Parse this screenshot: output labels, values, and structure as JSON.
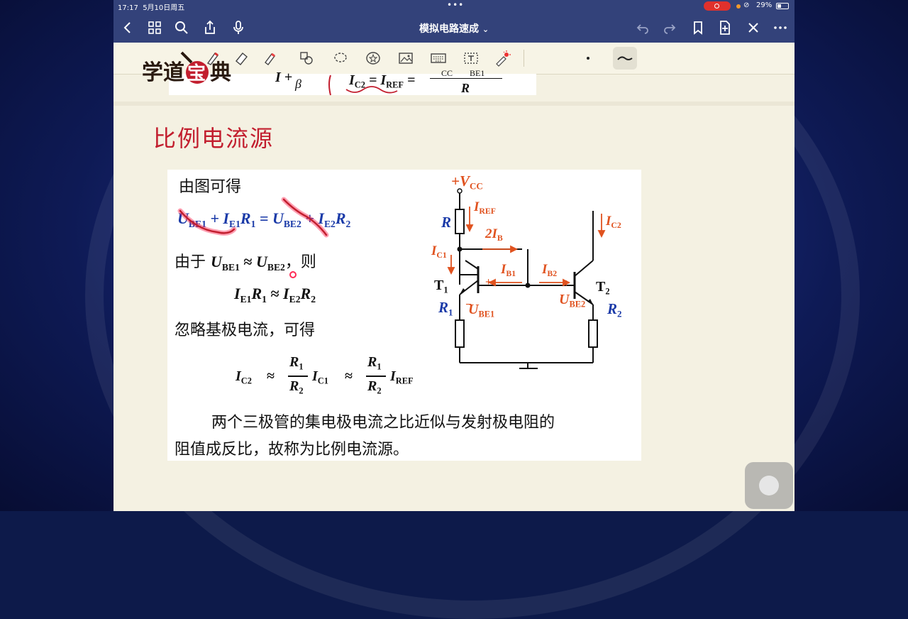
{
  "status": {
    "time": "17:17",
    "date": "5月10日周五",
    "battery": "29%"
  },
  "nav": {
    "title": "模拟电路速成",
    "title_chevron": "⌄"
  },
  "toolbar": {
    "tools": [
      "lasso-icon",
      "pen-icon",
      "eraser-icon",
      "highlighter-icon",
      "shapes-icon",
      "lasso-select-icon",
      "sticker-icon",
      "image-icon",
      "keyboard-icon",
      "text-icon",
      "laser-pointer-icon"
    ],
    "selected_pen": "wave-pen"
  },
  "logo": {
    "text": "学道宝典"
  },
  "top_formula": {
    "left": "I + ",
    "beta": "β",
    "ic2": "I",
    "ic2_sub": "C2",
    "eq": " = I",
    "ref_sub": "REF",
    "eq2": " =",
    "num_cc": "CC",
    "num_be": "BE1",
    "den": "R"
  },
  "heading": "比例电流源",
  "body": {
    "line1": "由图可得",
    "eq1": {
      "u": "U",
      "u_sub": "BE1",
      "plus": " + I",
      "e1_sub": "E1",
      "r1": "R",
      "r1_sub": "1",
      "eq": " = U",
      "u2_sub": "BE2",
      "plus2": " + I",
      "e2_sub": "E2",
      "r2": "R",
      "r2_sub": "2"
    },
    "line3_pre": "由于 ",
    "line3_u1": "U",
    "line3_u1_sub": "BE1",
    "line3_approx": " ≈ ",
    "line3_u2": "U",
    "line3_u2_sub": "BE2",
    "line3_post": "，则",
    "eq3": {
      "i1": "I",
      "i1_sub": "E1",
      "r1": "R",
      "r1_sub": "1",
      "approx": " ≈ ",
      "i2": "I",
      "i2_sub": "E2",
      "r2": "R",
      "r2_sub": "2"
    },
    "line5": "忽略基极电流，可得",
    "eq5": {
      "ic2": "I",
      "ic2_sub": "C2",
      "approx": "≈",
      "frac_num": "R",
      "frac_num_sub": "1",
      "frac_den": "R",
      "frac_den_sub": "2",
      "ic1": "I",
      "ic1_sub": "C1",
      "iref": "I",
      "iref_sub": "REF"
    },
    "para1": "两个三极管的集电极电流之比近似与发射极电阻的",
    "para2": "阻值成反比，故称为比例电流源。"
  },
  "circuit": {
    "vcc": "+V",
    "vcc_sub": "CC",
    "r": "R",
    "iref": "I",
    "iref_sub": "REF",
    "ic2": "I",
    "ic2_sub": "C2",
    "ib2x": "2I",
    "ib2x_sub": "B",
    "ic1": "I",
    "ic1_sub": "C1",
    "ib1": "I",
    "ib1_sub": "B1",
    "ib2": "I",
    "ib2_sub": "B2",
    "t1": "T",
    "t1_sub": "1",
    "t2": "T",
    "t2_sub": "2",
    "r1": "R",
    "r1_sub": "1",
    "r2": "R",
    "r2_sub": "2",
    "ube1": "U",
    "ube1_sub": "BE1",
    "ube2": "U",
    "ube2_sub": "BE2",
    "plus": "+",
    "minus": "−"
  },
  "colors": {
    "nav_bg": "#33427a",
    "page_bg": "#f4f1e2",
    "formula_blue": "#1a3aa8",
    "circuit_orange": "#e0521f",
    "ink_red": "#c21e2e"
  }
}
